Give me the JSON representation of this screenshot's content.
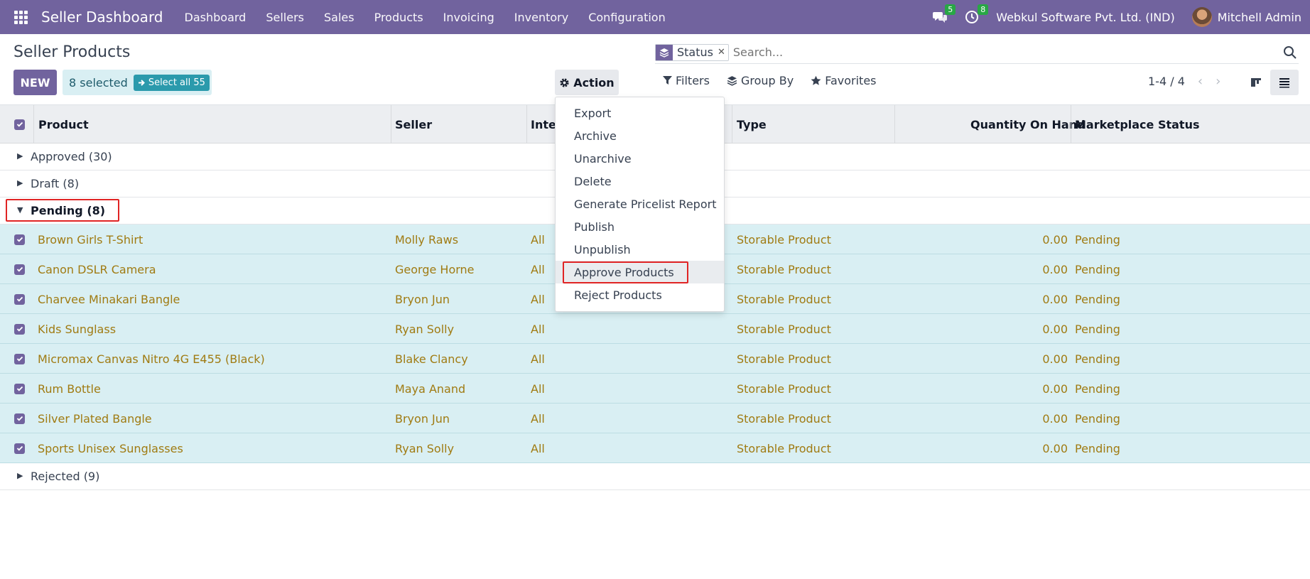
{
  "navbar": {
    "app_title": "Seller Dashboard",
    "menu": [
      "Dashboard",
      "Sellers",
      "Sales",
      "Products",
      "Invoicing",
      "Inventory",
      "Configuration"
    ],
    "messages_count": "5",
    "activities_count": "8",
    "company": "Webkul Software Pvt. Ltd. (IND)",
    "user": "Mitchell Admin"
  },
  "control_panel": {
    "title": "Seller Products",
    "new_label": "NEW",
    "selected_label": "8 selected",
    "select_all_label": "Select all 55",
    "action_label": "Action",
    "facet_label": "Status",
    "search_placeholder": "Search...",
    "filters_label": "Filters",
    "groupby_label": "Group By",
    "favorites_label": "Favorites",
    "pager": "1-4 / 4"
  },
  "columns": {
    "product": "Product",
    "seller": "Seller",
    "internal": "Inter",
    "type": "Type",
    "qty": "Quantity On Hand",
    "status": "Marketplace Status"
  },
  "groups": {
    "approved": "Approved (30)",
    "draft": "Draft (8)",
    "pending": "Pending (8)",
    "rejected": "Rejected (9)"
  },
  "rows": [
    {
      "product": "Brown Girls T-Shirt",
      "seller": "Molly Raws",
      "internal": "All",
      "type": "Storable Product",
      "qty": "0.00",
      "status": "Pending"
    },
    {
      "product": "Canon DSLR Camera",
      "seller": "George Horne",
      "internal": "All",
      "type": "Storable Product",
      "qty": "0.00",
      "status": "Pending"
    },
    {
      "product": "Charvee Minakari Bangle",
      "seller": "Bryon Jun",
      "internal": "All",
      "type": "Storable Product",
      "qty": "0.00",
      "status": "Pending"
    },
    {
      "product": "Kids Sunglass",
      "seller": "Ryan Solly",
      "internal": "All",
      "type": "Storable Product",
      "qty": "0.00",
      "status": "Pending"
    },
    {
      "product": "Micromax Canvas Nitro 4G E455 (Black)",
      "seller": "Blake Clancy",
      "internal": "All",
      "type": "Storable Product",
      "qty": "0.00",
      "status": "Pending"
    },
    {
      "product": "Rum Bottle",
      "seller": "Maya Anand",
      "internal": "All",
      "type": "Storable Product",
      "qty": "0.00",
      "status": "Pending"
    },
    {
      "product": "Silver Plated Bangle",
      "seller": "Bryon Jun",
      "internal": "All",
      "type": "Storable Product",
      "qty": "0.00",
      "status": "Pending"
    },
    {
      "product": "Sports Unisex Sunglasses",
      "seller": "Ryan Solly",
      "internal": "All",
      "type": "Storable Product",
      "qty": "0.00",
      "status": "Pending"
    }
  ],
  "action_menu": [
    "Export",
    "Archive",
    "Unarchive",
    "Delete",
    "Generate Pricelist Report",
    "Publish",
    "Unpublish",
    "Approve Products",
    "Reject Products"
  ],
  "colors": {
    "brand": "#71639e",
    "selected_row": "#d9eff3",
    "link_text": "#a07b12",
    "highlight": "#e02424",
    "badge": "#28a745"
  }
}
